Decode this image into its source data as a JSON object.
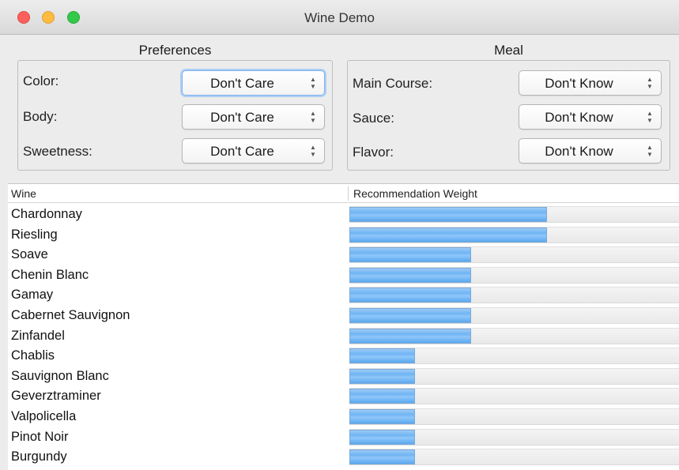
{
  "window": {
    "title": "Wine Demo"
  },
  "preferences": {
    "title": "Preferences",
    "fields": [
      {
        "label": "Color:",
        "value": "Don't Care"
      },
      {
        "label": "Body:",
        "value": "Don't Care"
      },
      {
        "label": "Sweetness:",
        "value": "Don't Care"
      }
    ]
  },
  "meal": {
    "title": "Meal",
    "fields": [
      {
        "label": "Main Course:",
        "value": "Don't Know"
      },
      {
        "label": "Sauce:",
        "value": "Don't Know"
      },
      {
        "label": "Flavor:",
        "value": "Don't Know"
      }
    ]
  },
  "table": {
    "columns": [
      "Wine",
      "Recommendation Weight"
    ],
    "rows": [
      {
        "wine": "Chardonnay",
        "weight": 0.6
      },
      {
        "wine": "Riesling",
        "weight": 0.6
      },
      {
        "wine": "Soave",
        "weight": 0.37
      },
      {
        "wine": "Chenin Blanc",
        "weight": 0.37
      },
      {
        "wine": "Gamay",
        "weight": 0.37
      },
      {
        "wine": "Cabernet Sauvignon",
        "weight": 0.37
      },
      {
        "wine": "Zinfandel",
        "weight": 0.37
      },
      {
        "wine": "Chablis",
        "weight": 0.2
      },
      {
        "wine": "Sauvignon Blanc",
        "weight": 0.2
      },
      {
        "wine": "Geverztraminer",
        "weight": 0.2
      },
      {
        "wine": "Valpolicella",
        "weight": 0.2
      },
      {
        "wine": "Pinot Noir",
        "weight": 0.2
      },
      {
        "wine": "Burgundy",
        "weight": 0.2
      }
    ]
  },
  "colors": {
    "accent": "#6fb4f3",
    "focus": "#aecff5"
  }
}
